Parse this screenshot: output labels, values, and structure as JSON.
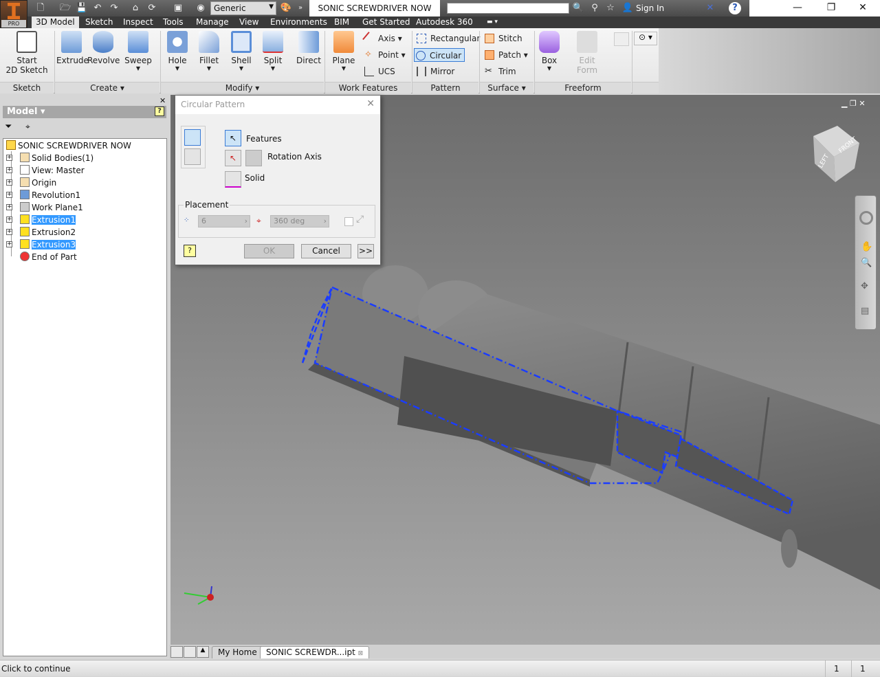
{
  "app": {
    "badge": "PRO",
    "document_title": "SONIC SCREWDRIVER NOW",
    "appearance": "Generic",
    "sign_in": "Sign In",
    "search_placeholder": ""
  },
  "window_controls": {
    "minimize": "—",
    "restore": "❐",
    "close": "✕"
  },
  "menu_tabs": [
    "3D Model",
    "Sketch",
    "Inspect",
    "Tools",
    "Manage",
    "View",
    "Environments",
    "BIM",
    "Get Started",
    "Autodesk 360"
  ],
  "ribbon": {
    "sketch": {
      "label": "Sketch",
      "start": "Start",
      "start2": "2D Sketch"
    },
    "create": {
      "label": "Create",
      "items": [
        "Extrude",
        "Revolve",
        "Sweep"
      ]
    },
    "modify": {
      "label": "Modify",
      "items": [
        "Hole",
        "Fillet",
        "Shell",
        "Split",
        "Direct"
      ]
    },
    "work_features": {
      "label": "Work Features",
      "plane": "Plane",
      "axis": "Axis",
      "point": "Point",
      "ucs": "UCS"
    },
    "pattern": {
      "label": "Pattern",
      "rectangular": "Rectangular",
      "circular": "Circular",
      "mirror": "Mirror"
    },
    "surface": {
      "label": "Surface",
      "stitch": "Stitch",
      "patch": "Patch",
      "trim": "Trim"
    },
    "freeform": {
      "label": "Freeform",
      "box": "Box",
      "edit": "Edit",
      "form": "Form"
    }
  },
  "browser": {
    "title": "Model",
    "root": "SONIC SCREWDRIVER NOW",
    "nodes": [
      {
        "label": "Solid Bodies(1)",
        "selected": false
      },
      {
        "label": "View: Master",
        "selected": false
      },
      {
        "label": "Origin",
        "selected": false
      },
      {
        "label": "Revolution1",
        "selected": false
      },
      {
        "label": "Work Plane1",
        "selected": false
      },
      {
        "label": "Extrusion1",
        "selected": true
      },
      {
        "label": "Extrusion2",
        "selected": false
      },
      {
        "label": "Extrusion3",
        "selected": true
      },
      {
        "label": "End of Part",
        "selected": false
      }
    ]
  },
  "dialog": {
    "title": "Circular Pattern",
    "features": "Features",
    "rotation_axis": "Rotation Axis",
    "solid": "Solid",
    "placement": "Placement",
    "count": "6",
    "angle": "360 deg",
    "ok": "OK",
    "cancel": "Cancel",
    "more": ">>"
  },
  "viewcube": {
    "front": "FRONT",
    "left": "LEFT"
  },
  "doc_tabs": [
    "My Home",
    "SONIC SCREWDR...ipt"
  ],
  "status": {
    "message": "Click to continue",
    "count1": "1",
    "count2": "1"
  },
  "colors": {
    "selection": "#1a3cff",
    "highlight": "#3399ff",
    "accent": "#e07020"
  }
}
